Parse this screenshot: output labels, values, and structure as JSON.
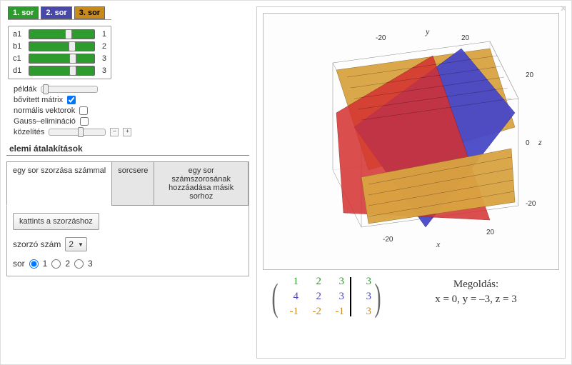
{
  "row_tabs": [
    "1. sor",
    "2. sor",
    "3. sor"
  ],
  "sliders": [
    {
      "label": "a1",
      "value": 1,
      "pos": 55
    },
    {
      "label": "b1",
      "value": 2,
      "pos": 60
    },
    {
      "label": "c1",
      "value": 3,
      "pos": 62
    },
    {
      "label": "d1",
      "value": 3,
      "pos": 62
    }
  ],
  "options": {
    "peldak_label": "példák",
    "bov_matrix_label": "bővített mátrix",
    "bov_matrix_checked": true,
    "norm_vectors_label": "normális vektorok",
    "norm_vectors_checked": false,
    "gauss_label": "Gauss–elimináció",
    "gauss_checked": false,
    "kozelites_label": "közelítés"
  },
  "ops": {
    "section_title": "elemi átalakítások",
    "tabs": [
      "egy sor szorzása számmal",
      "sorcsere",
      "egy sor számszorosának hozzáadása másik sorhoz"
    ],
    "active_tab": 0,
    "multiply_button": "kattints a szorzáshoz",
    "multiplier_label": "szorzó szám",
    "multiplier_value": "2",
    "row_label": "sor",
    "row_options": [
      "1",
      "2",
      "3"
    ],
    "row_selected": 0
  },
  "matrix": {
    "rows": [
      {
        "vals": [
          "1",
          "2",
          "3"
        ],
        "aug": "3",
        "color": "#2e9b2e"
      },
      {
        "vals": [
          "4",
          "2",
          "3"
        ],
        "aug": "3",
        "color": "#4848c8"
      },
      {
        "vals": [
          "-1",
          "-2",
          "-1"
        ],
        "aug": "3",
        "color": "#c88a1c"
      }
    ]
  },
  "solution": {
    "title": "Megoldás:",
    "text": "x = 0,  y = –3,  z = 3"
  },
  "axes": {
    "x_label": "x",
    "y_label": "y",
    "z_label": "z",
    "ticks_x": [
      "-20",
      "20"
    ],
    "ticks_y": [
      "-20",
      "20"
    ],
    "ticks_z": [
      "-20",
      "0",
      "20"
    ]
  },
  "chart_data": {
    "type": "3d-planes",
    "description": "Three intersecting planes in 3D box",
    "box_range": {
      "x": [
        -25,
        25
      ],
      "y": [
        -25,
        25
      ],
      "z": [
        -25,
        25
      ]
    },
    "planes": [
      {
        "name": "row1",
        "color": "#c88a1c",
        "equation": "1x + 2y + 3z = 3"
      },
      {
        "name": "row2",
        "color": "#4848c8",
        "equation": "4x + 2y + 3z = 3"
      },
      {
        "name": "row3",
        "color": "#d53030",
        "equation": "-1x - 2y - 1z = 3"
      }
    ],
    "intersection_point": {
      "x": 0,
      "y": -3,
      "z": 3
    }
  }
}
